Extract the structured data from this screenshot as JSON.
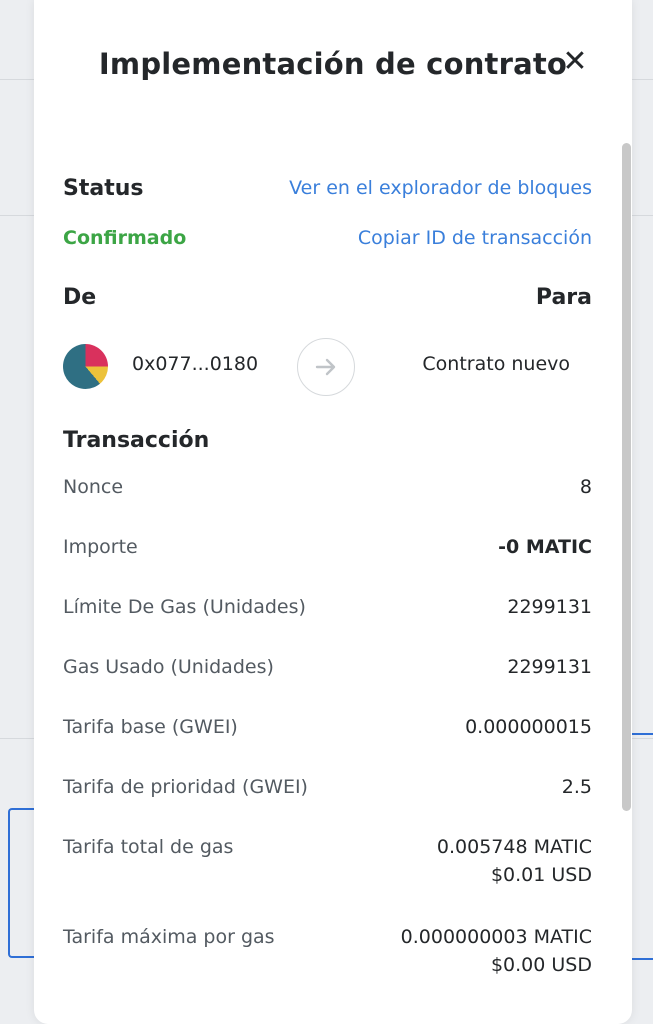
{
  "modal": {
    "title": "Implementación de contrato",
    "close_icon": "close-icon"
  },
  "status": {
    "label": "Status",
    "value": "Confirmado",
    "value_color": "#3ca545",
    "explorer_link": "Ver en el explorador de bloques",
    "copy_link": "Copiar ID de transacción"
  },
  "transfer": {
    "from_label": "De",
    "to_label": "Para",
    "from_address": "0x077...0180",
    "to_address": "Contrato nuevo",
    "arrow_icon": "arrow-right-icon"
  },
  "transaction": {
    "heading": "Transacción",
    "rows": [
      {
        "label": "Nonce",
        "value": "8"
      },
      {
        "label": "Importe",
        "value": "-0 MATIC"
      },
      {
        "label": "Límite De Gas (Unidades)",
        "value": "2299131"
      },
      {
        "label": "Gas Usado (Unidades)",
        "value": "2299131"
      },
      {
        "label": "Tarifa base (GWEI)",
        "value": "0.000000015"
      },
      {
        "label": "Tarifa de prioridad (GWEI)",
        "value": "2.5"
      },
      {
        "label": "Tarifa total de gas",
        "value": "0.005748 MATIC",
        "sub": "$0.01 USD"
      },
      {
        "label": "Tarifa máxima por gas",
        "value": "0.000000003 MATIC",
        "sub": "$0.00 USD"
      }
    ]
  },
  "colors": {
    "link": "#3a7fdb",
    "text": "#24272a",
    "muted": "#535a61",
    "confirmed": "#3ca545"
  }
}
